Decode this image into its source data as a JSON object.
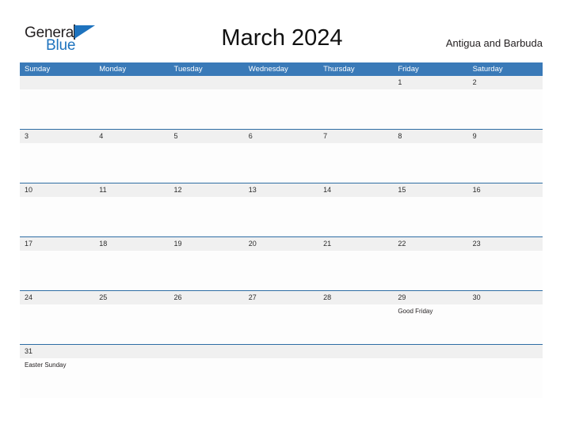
{
  "brand": {
    "name_part1": "General",
    "name_part2": "Blue",
    "flag_icon": "flag-triangle-icon",
    "colors": {
      "dark": "#231F20",
      "blue": "#1E73BE"
    }
  },
  "header": {
    "title": "March 2024",
    "country": "Antigua and Barbuda"
  },
  "theme": {
    "header_blue": "#3A7AB8",
    "row_divider_blue": "#2E6DA4",
    "number_band_gray": "#F0F0F0",
    "cell_white": "#FDFDFD",
    "text_dark": "#2B2B2B"
  },
  "calendar": {
    "day_headers": [
      "Sunday",
      "Monday",
      "Tuesday",
      "Wednesday",
      "Thursday",
      "Friday",
      "Saturday"
    ],
    "weeks": [
      {
        "days": [
          {
            "num": "",
            "events": []
          },
          {
            "num": "",
            "events": []
          },
          {
            "num": "",
            "events": []
          },
          {
            "num": "",
            "events": []
          },
          {
            "num": "",
            "events": []
          },
          {
            "num": "1",
            "events": []
          },
          {
            "num": "2",
            "events": []
          }
        ]
      },
      {
        "days": [
          {
            "num": "3",
            "events": []
          },
          {
            "num": "4",
            "events": []
          },
          {
            "num": "5",
            "events": []
          },
          {
            "num": "6",
            "events": []
          },
          {
            "num": "7",
            "events": []
          },
          {
            "num": "8",
            "events": []
          },
          {
            "num": "9",
            "events": []
          }
        ]
      },
      {
        "days": [
          {
            "num": "10",
            "events": []
          },
          {
            "num": "11",
            "events": []
          },
          {
            "num": "12",
            "events": []
          },
          {
            "num": "13",
            "events": []
          },
          {
            "num": "14",
            "events": []
          },
          {
            "num": "15",
            "events": []
          },
          {
            "num": "16",
            "events": []
          }
        ]
      },
      {
        "days": [
          {
            "num": "17",
            "events": []
          },
          {
            "num": "18",
            "events": []
          },
          {
            "num": "19",
            "events": []
          },
          {
            "num": "20",
            "events": []
          },
          {
            "num": "21",
            "events": []
          },
          {
            "num": "22",
            "events": []
          },
          {
            "num": "23",
            "events": []
          }
        ]
      },
      {
        "days": [
          {
            "num": "24",
            "events": []
          },
          {
            "num": "25",
            "events": []
          },
          {
            "num": "26",
            "events": []
          },
          {
            "num": "27",
            "events": []
          },
          {
            "num": "28",
            "events": []
          },
          {
            "num": "29",
            "events": [
              "Good Friday"
            ]
          },
          {
            "num": "30",
            "events": []
          }
        ]
      },
      {
        "days": [
          {
            "num": "31",
            "events": [
              "Easter Sunday"
            ]
          },
          {
            "num": "",
            "events": []
          },
          {
            "num": "",
            "events": []
          },
          {
            "num": "",
            "events": []
          },
          {
            "num": "",
            "events": []
          },
          {
            "num": "",
            "events": []
          },
          {
            "num": "",
            "events": []
          }
        ]
      }
    ]
  }
}
